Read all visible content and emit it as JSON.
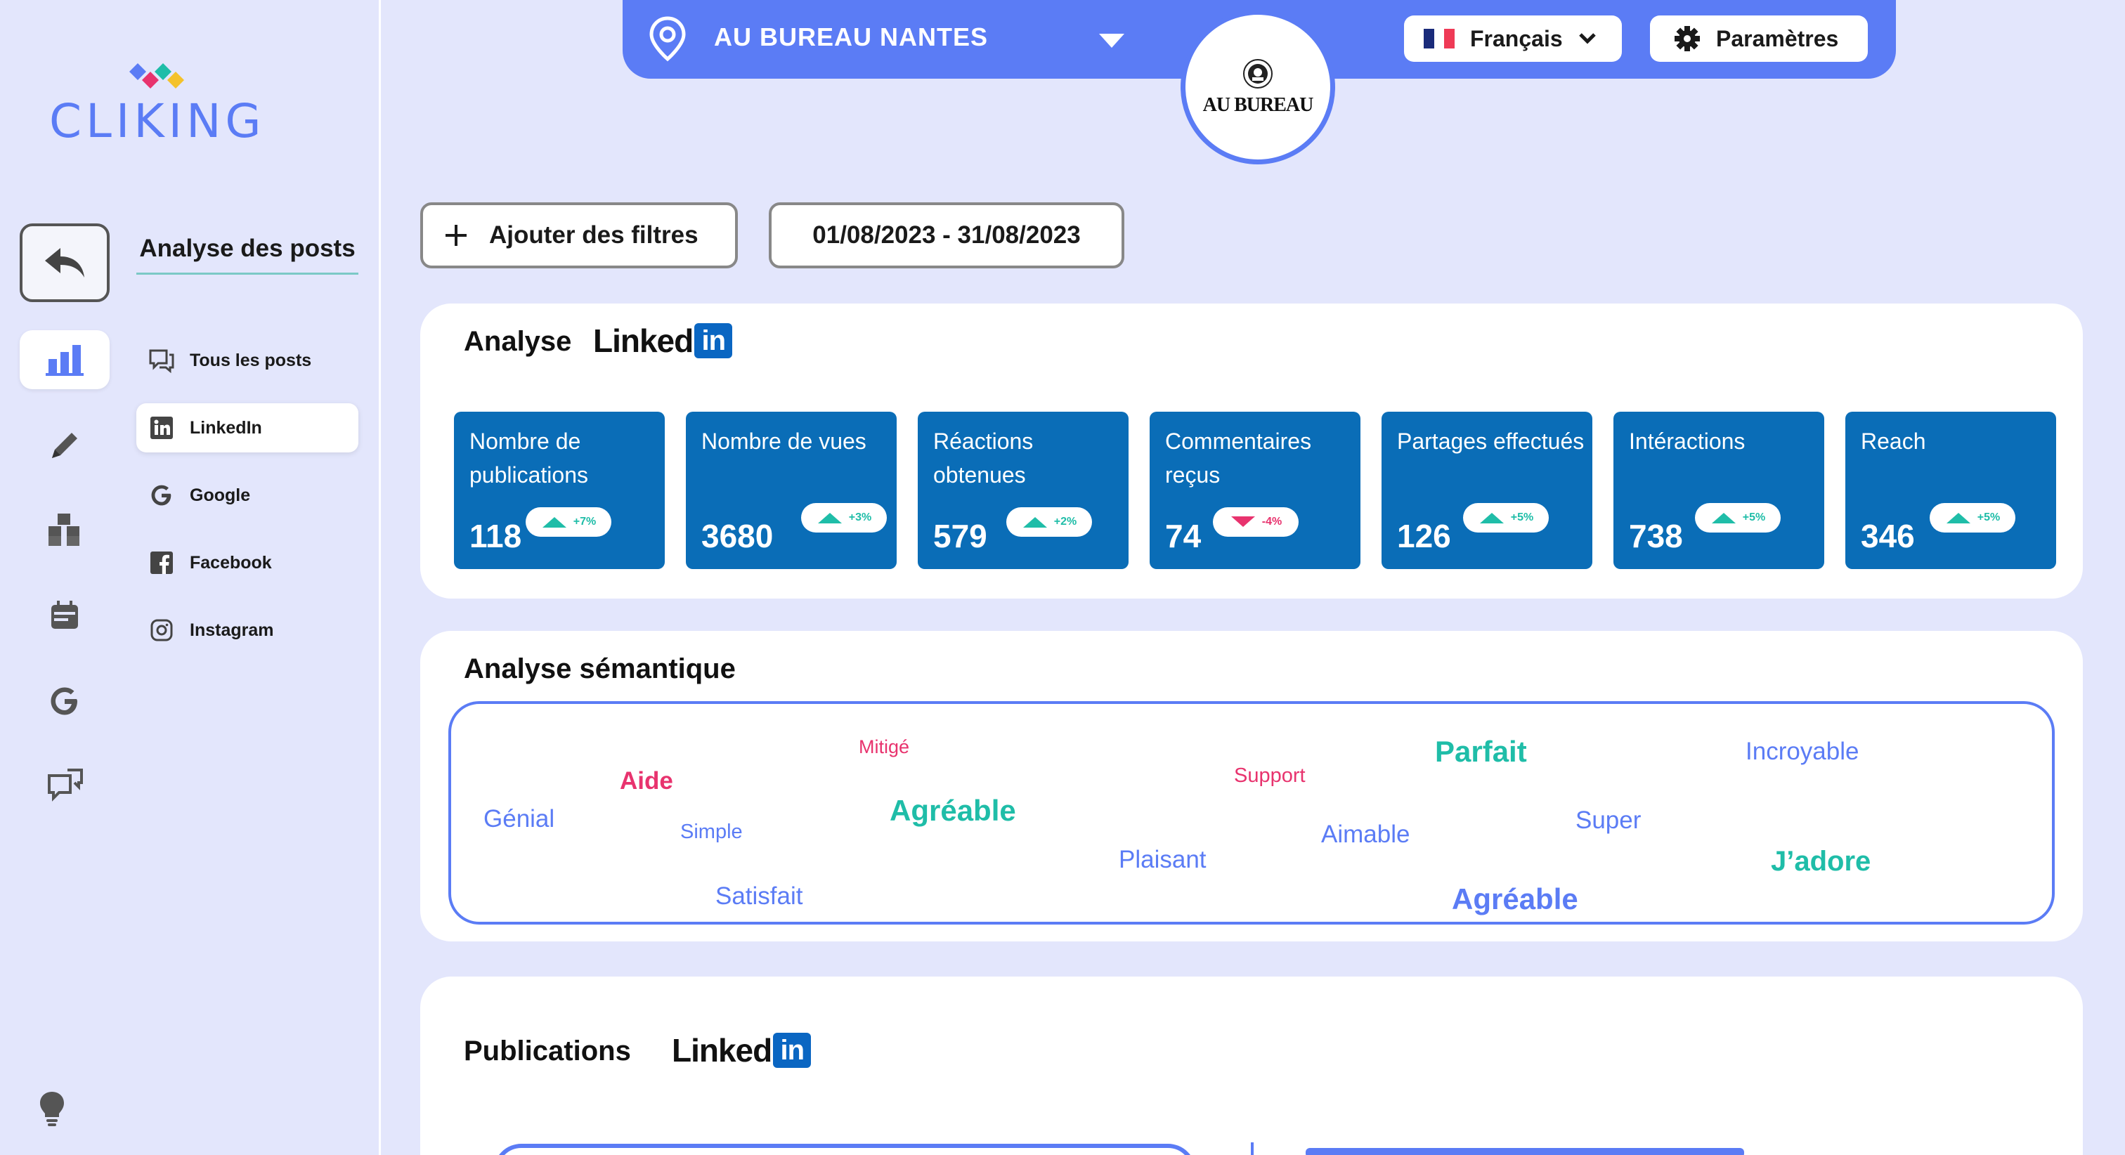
{
  "sidebar": {
    "logo_text": "CLIKING",
    "nav_icons": [
      {
        "icon": "back-arrow-icon",
        "active": false
      },
      {
        "icon": "bar-chart-icon",
        "active": true
      },
      {
        "icon": "pencil-icon",
        "active": false
      },
      {
        "icon": "cubes-icon",
        "active": false
      },
      {
        "icon": "calendar-icon",
        "active": false
      },
      {
        "icon": "google-icon",
        "active": false
      },
      {
        "icon": "chat-icon",
        "active": false
      }
    ],
    "bottom_icon": "lightbulb-icon",
    "submenu_title": "Analyse des posts",
    "submenu_items": [
      {
        "label": "Tous les posts",
        "icon": "chat-bubbles-icon",
        "active": false
      },
      {
        "label": "LinkedIn",
        "icon": "linkedin-icon",
        "active": true
      },
      {
        "label": "Google",
        "icon": "google-icon",
        "active": false
      },
      {
        "label": "Facebook",
        "icon": "facebook-icon",
        "active": false
      },
      {
        "label": "Instagram",
        "icon": "instagram-icon",
        "active": false
      }
    ]
  },
  "topbar": {
    "location_name": "AU BUREAU NANTES",
    "brand_name": "AU BUREAU",
    "language_label": "Français",
    "settings_label": "Paramètres"
  },
  "filters": {
    "add_filters_label": "Ajouter des filtres",
    "date_range": "01/08/2023 - 31/08/2023"
  },
  "linkedin_analysis": {
    "title": "Analyse",
    "brand_word": "Linked",
    "brand_in": "in",
    "kpis": [
      {
        "label": "Nombre de publications",
        "value": "118",
        "delta": "+7%",
        "trend": "up"
      },
      {
        "label": "Nombre de vues",
        "value": "3680",
        "delta": "+3%",
        "trend": "up"
      },
      {
        "label": "Réactions obtenues",
        "value": "579",
        "delta": "+2%",
        "trend": "up"
      },
      {
        "label": "Commentaires reçus",
        "value": "74",
        "delta": "-4%",
        "trend": "down"
      },
      {
        "label": "Partages effectués",
        "value": "126",
        "delta": "+5%",
        "trend": "up"
      },
      {
        "label": "Intéractions",
        "value": "738",
        "delta": "+5%",
        "trend": "up"
      },
      {
        "label": "Reach",
        "value": "346",
        "delta": "+5%",
        "trend": "up"
      }
    ]
  },
  "semantic_analysis": {
    "title": "Analyse sémantique",
    "words": [
      {
        "text": "Génial",
        "color": "#5b7cf5"
      },
      {
        "text": "Aide",
        "color": "#e8336e"
      },
      {
        "text": "Simple",
        "color": "#5b7cf5"
      },
      {
        "text": "Satisfait",
        "color": "#5b7cf5"
      },
      {
        "text": "Mitigé",
        "color": "#e8336e"
      },
      {
        "text": "Agréable",
        "color": "#1fbda8"
      },
      {
        "text": "Plaisant",
        "color": "#5b7cf5"
      },
      {
        "text": "Support",
        "color": "#e8336e"
      },
      {
        "text": "Aimable",
        "color": "#5b7cf5"
      },
      {
        "text": "Parfait",
        "color": "#1fbda8"
      },
      {
        "text": "Agréable",
        "color": "#5b7cf5"
      },
      {
        "text": "Super",
        "color": "#5b7cf5"
      },
      {
        "text": "Incroyable",
        "color": "#5b7cf5"
      },
      {
        "text": "J’adore",
        "color": "#1fbda8"
      }
    ]
  },
  "publications": {
    "title": "Publications",
    "brand_word": "Linked",
    "brand_in": "in"
  },
  "colors": {
    "accent": "#5b7cf5",
    "kpi_card": "#0a6db7",
    "positive": "#1fbda8",
    "negative": "#e8336e",
    "linkedin_blue": "#0a66c2"
  }
}
